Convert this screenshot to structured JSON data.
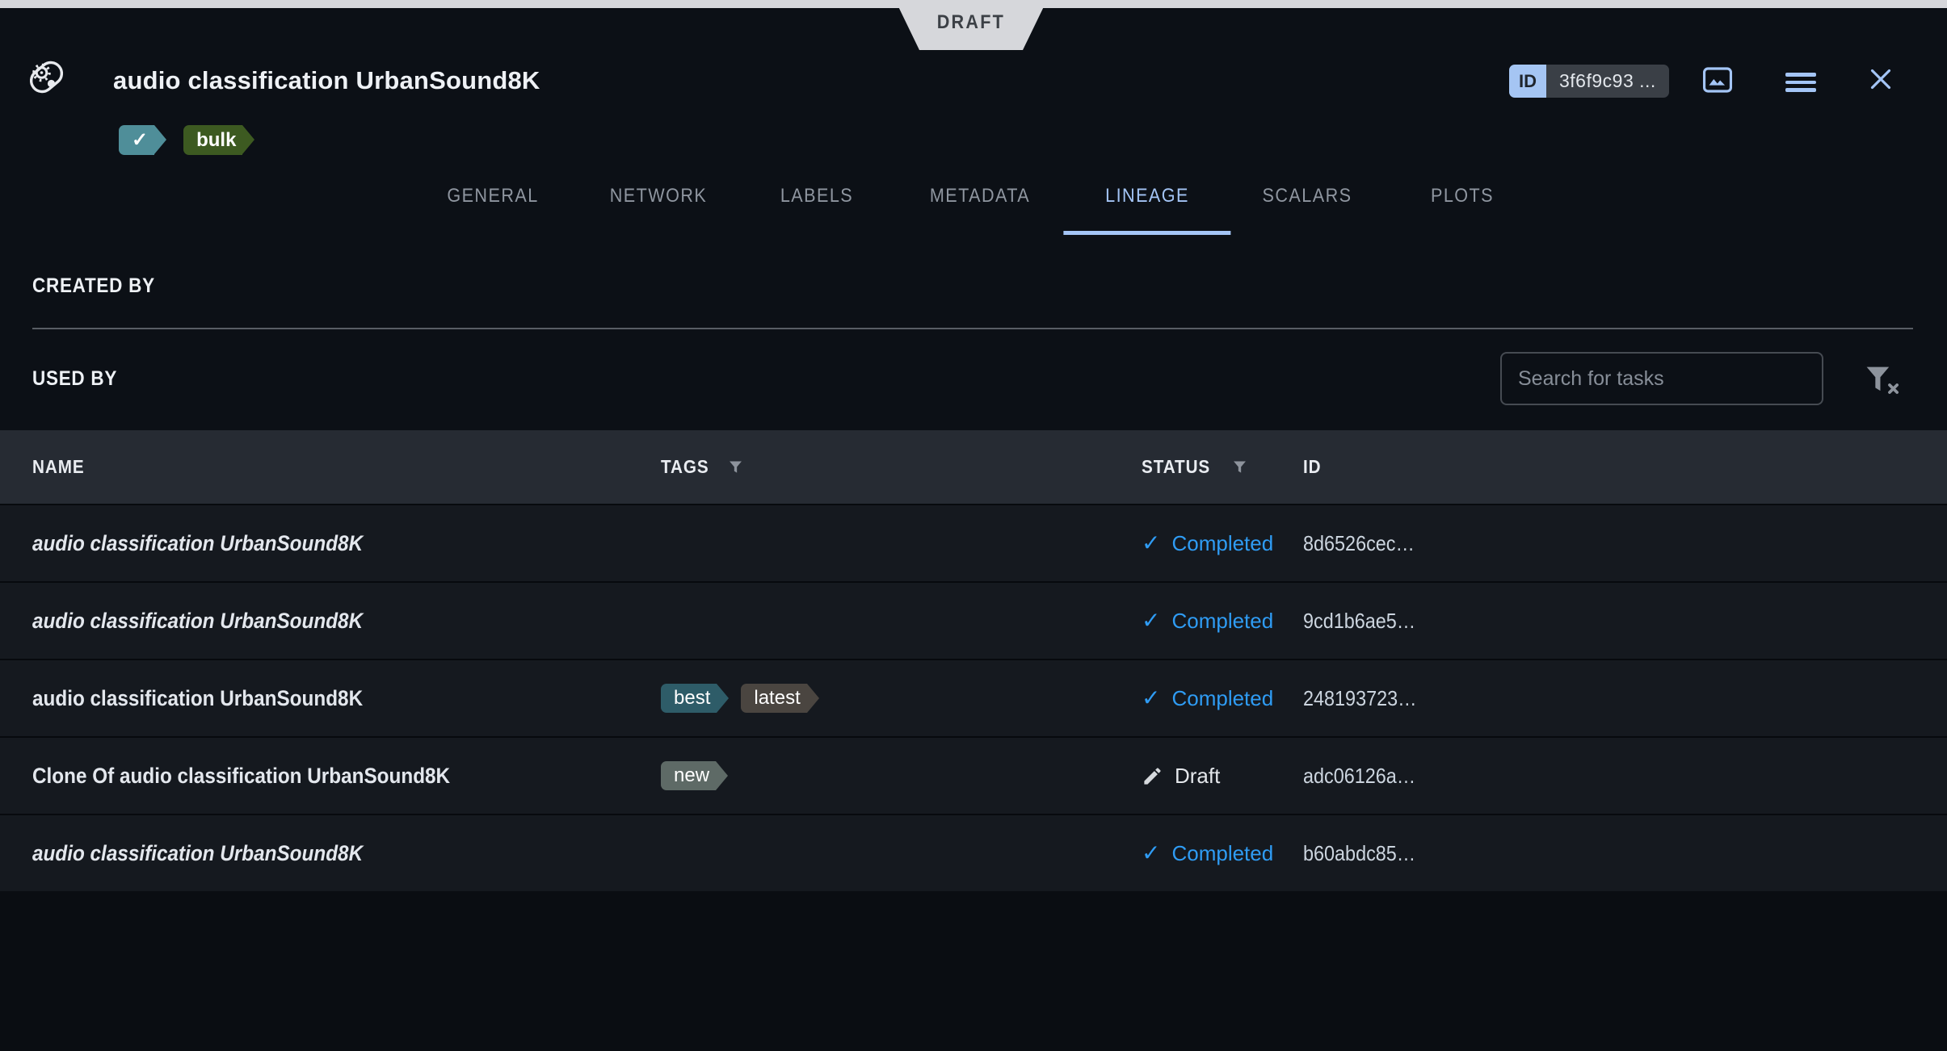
{
  "ribbon": {
    "label": "DRAFT"
  },
  "header": {
    "title": "audio classification UrbanSound8K",
    "id_badge": {
      "label": "ID",
      "value": "3f6f9c93 ..."
    },
    "tags": [
      {
        "label": "✓",
        "color": "#4f8e99"
      },
      {
        "label": "bulk",
        "color": "#3d5a21"
      }
    ],
    "icons": {
      "plots": "image-icon",
      "menu": "hamburger-icon",
      "close": "close-icon"
    }
  },
  "tabs": {
    "active": "LINEAGE",
    "items": [
      "GENERAL",
      "NETWORK",
      "LABELS",
      "METADATA",
      "LINEAGE",
      "SCALARS",
      "PLOTS"
    ]
  },
  "sections": {
    "created_by": "CREATED BY",
    "used_by": "USED BY"
  },
  "search": {
    "placeholder": "Search for tasks"
  },
  "table": {
    "headers": {
      "name": "NAME",
      "tags": "TAGS",
      "status": "STATUS",
      "id": "ID"
    },
    "rows": [
      {
        "name": "audio classification UrbanSound8K",
        "italic": true,
        "tags": [],
        "status": "Completed",
        "id": "8d6526cec…"
      },
      {
        "name": "audio classification UrbanSound8K",
        "italic": true,
        "tags": [],
        "status": "Completed",
        "id": "9cd1b6ae5…"
      },
      {
        "name": "audio classification UrbanSound8K",
        "italic": false,
        "tags": [
          {
            "label": "best",
            "color": "#2e5c68"
          },
          {
            "label": "latest",
            "color": "#4a4540"
          }
        ],
        "status": "Completed",
        "id": "248193723…"
      },
      {
        "name": "Clone Of audio classification UrbanSound8K",
        "italic": false,
        "tags": [
          {
            "label": "new",
            "color": "#5e6a66"
          }
        ],
        "status": "Draft",
        "id": "adc06126a…"
      },
      {
        "name": "audio classification UrbanSound8K",
        "italic": true,
        "tags": [],
        "status": "Completed",
        "id": "b60abdc85…"
      }
    ]
  },
  "colors": {
    "accent_blue": "#a4c5f6",
    "status_completed": "#2f9cf4",
    "ribbon_bg": "#d6d7db",
    "table_header_bg": "#262b33"
  }
}
